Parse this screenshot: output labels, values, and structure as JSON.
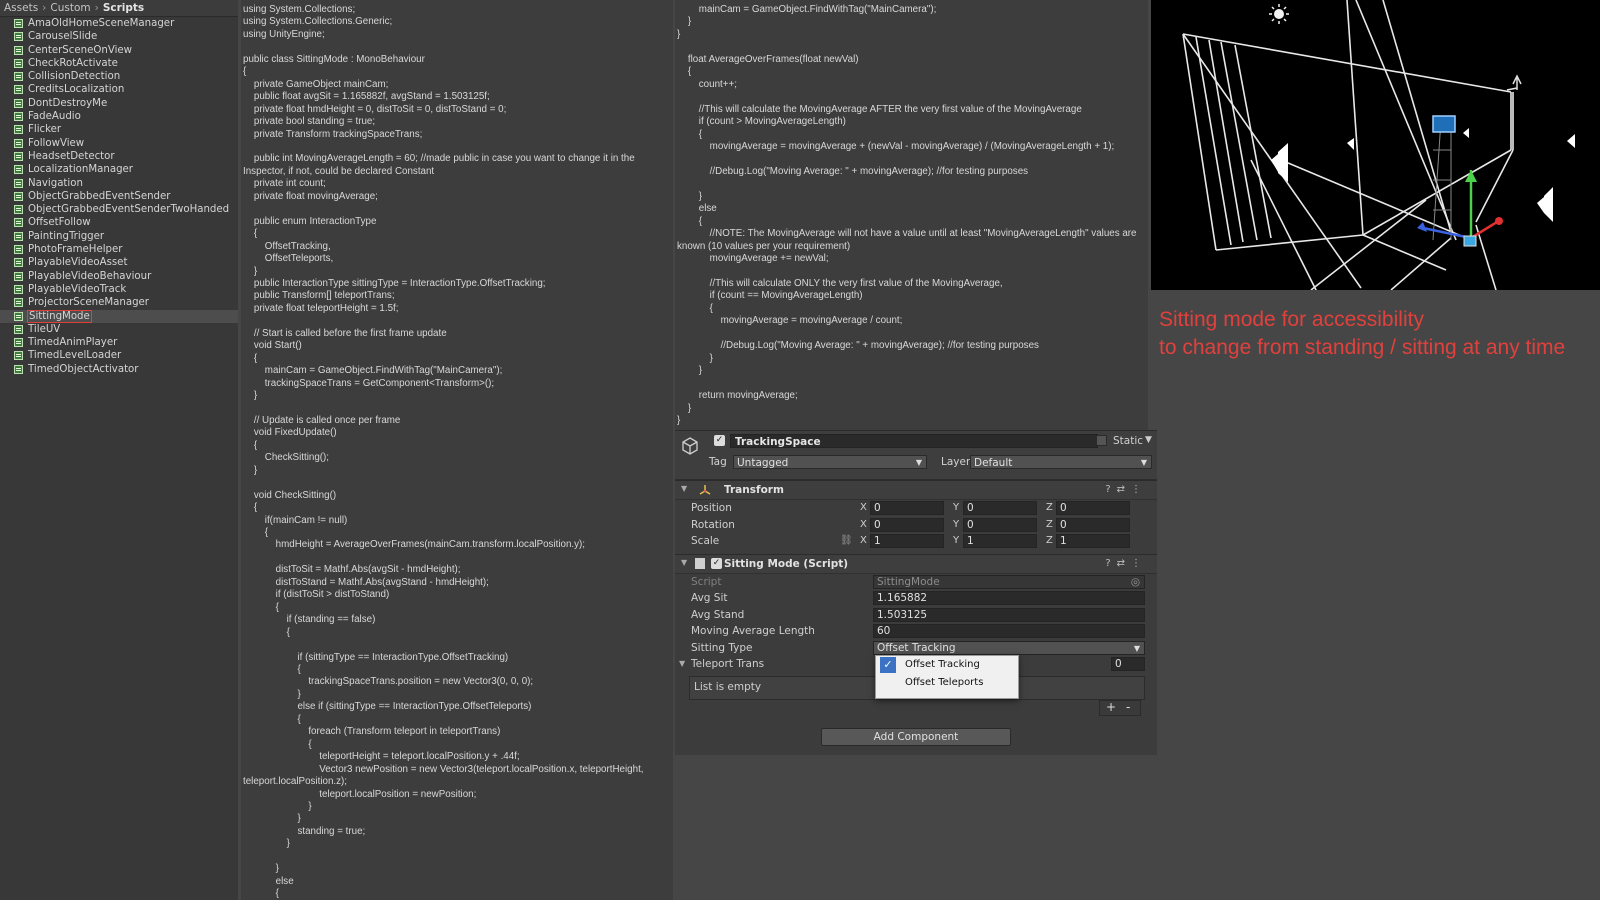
{
  "breadcrumb": [
    "Assets",
    "Custom",
    "Scripts"
  ],
  "files": [
    "AmaOldHomeSceneManager",
    "CarouselSlide",
    "CenterSceneOnView",
    "CheckRotActivate",
    "CollisionDetection",
    "CreditsLocalization",
    "DontDestroyMe",
    "FadeAudio",
    "Flicker",
    "FollowView",
    "HeadsetDetector",
    "LocalizationManager",
    "Navigation",
    "ObjectGrabbedEventSender",
    "ObjectGrabbedEventSenderTwoHanded",
    "OffsetFollow",
    "PaintingTrigger",
    "PhotoFrameHelper",
    "PlayableVideoAsset",
    "PlayableVideoBehaviour",
    "PlayableVideoTrack",
    "ProjectorSceneManager",
    "SittingMode",
    "TileUV",
    "TimedAnimPlayer",
    "TimedLevelLoader",
    "TimedObjectActivator"
  ],
  "selected_file": "SittingMode",
  "code_left": "using System.Collections;\nusing System.Collections.Generic;\nusing UnityEngine;\n\npublic class SittingMode : MonoBehaviour\n{\n    private GameObject mainCam;\n    public float avgSit = 1.165882f, avgStand = 1.503125f;\n    private float hmdHeight = 0, distToSit = 0, distToStand = 0;\n    private bool standing = true;\n    private Transform trackingSpaceTrans;\n\n    public int MovingAverageLength = 60; //made public in case you want to change it in the Inspector, if not, could be declared Constant\n    private int count;\n    private float movingAverage;\n\n    public enum InteractionType\n    {\n        OffsetTracking,\n        OffsetTeleports,\n    }\n    public InteractionType sittingType = InteractionType.OffsetTracking;\n    public Transform[] teleportTrans;\n    private float teleportHeight = 1.5f;\n\n    // Start is called before the first frame update\n    void Start()\n    {\n        mainCam = GameObject.FindWithTag(\"MainCamera\");\n        trackingSpaceTrans = GetComponent<Transform>();\n    }\n\n    // Update is called once per frame\n    void FixedUpdate()\n    {\n        CheckSitting();\n    }\n\n    void CheckSitting()\n    {\n        if(mainCam != null)\n        {\n            hmdHeight = AverageOverFrames(mainCam.transform.localPosition.y);\n\n            distToSit = Mathf.Abs(avgSit - hmdHeight);\n            distToStand = Mathf.Abs(avgStand - hmdHeight);\n            if (distToSit > distToStand)\n            {\n                if (standing == false)\n                {\n\n                    if (sittingType == InteractionType.OffsetTracking)\n                    {\n                        trackingSpaceTrans.position = new Vector3(0, 0, 0);\n                    }\n                    else if (sittingType == InteractionType.OffsetTeleports)\n                    {\n                        foreach (Transform teleport in teleportTrans)\n                        {\n                            teleportHeight = teleport.localPosition.y + .44f;\n                            Vector3 newPosition = new Vector3(teleport.localPosition.x, teleportHeight, teleport.localPosition.z);\n                            teleport.localPosition = newPosition;\n                        }\n                    }\n                    standing = true;\n                }\n\n            }\n            else\n            {",
  "code_right": "        mainCam = GameObject.FindWithTag(\"MainCamera\");\n    }\n}\n\n    float AverageOverFrames(float newVal)\n    {\n        count++;\n\n        //This will calculate the MovingAverage AFTER the very first value of the MovingAverage\n        if (count > MovingAverageLength)\n        {\n            movingAverage = movingAverage + (newVal - movingAverage) / (MovingAverageLength + 1);\n\n            //Debug.Log(\"Moving Average: \" + movingAverage); //for testing purposes\n\n        }\n        else\n        {\n            //NOTE: The MovingAverage will not have a value until at least \"MovingAverageLength\" values are known (10 values per your requirement)\n            movingAverage += newVal;\n\n            //This will calculate ONLY the very first value of the MovingAverage,\n            if (count == MovingAverageLength)\n            {\n                movingAverage = movingAverage / count;\n\n                //Debug.Log(\"Moving Average: \" + movingAverage); //for testing purposes\n            }\n        }\n\n        return movingAverage;\n    }\n}",
  "inspector": {
    "object_name": "TrackingSpace",
    "static_label": "Static",
    "tag_label": "Tag",
    "tag_value": "Untagged",
    "layer_label": "Layer",
    "layer_value": "Default",
    "transform": {
      "title": "Transform",
      "rows": [
        {
          "label": "Position",
          "x": "0",
          "y": "0",
          "z": "0"
        },
        {
          "label": "Rotation",
          "x": "0",
          "y": "0",
          "z": "0"
        },
        {
          "label": "Scale",
          "x": "1",
          "y": "1",
          "z": "1"
        }
      ]
    },
    "script_component": {
      "title": "Sitting Mode (Script)",
      "script_label": "Script",
      "script_value": "SittingMode",
      "avg_sit_label": "Avg Sit",
      "avg_sit": "1.165882",
      "avg_stand_label": "Avg Stand",
      "avg_stand": "1.503125",
      "mal_label": "Moving Average Length",
      "mal": "60",
      "sitting_type_label": "Sitting Type",
      "sitting_type": "Offset Tracking",
      "teleport_label": "Teleport Trans",
      "teleport_count": "0",
      "list_empty": "List is empty"
    },
    "dropdown_options": [
      "Offset Tracking",
      "Offset Teleports"
    ],
    "add_component": "Add Component"
  },
  "caption_line1": "Sitting mode for accessibility",
  "caption_line2": "to change from standing / sitting at any time",
  "colors": {
    "caption": "#e0413d",
    "selection_outline": "#e0403a",
    "check_blue": "#3b72c4"
  }
}
